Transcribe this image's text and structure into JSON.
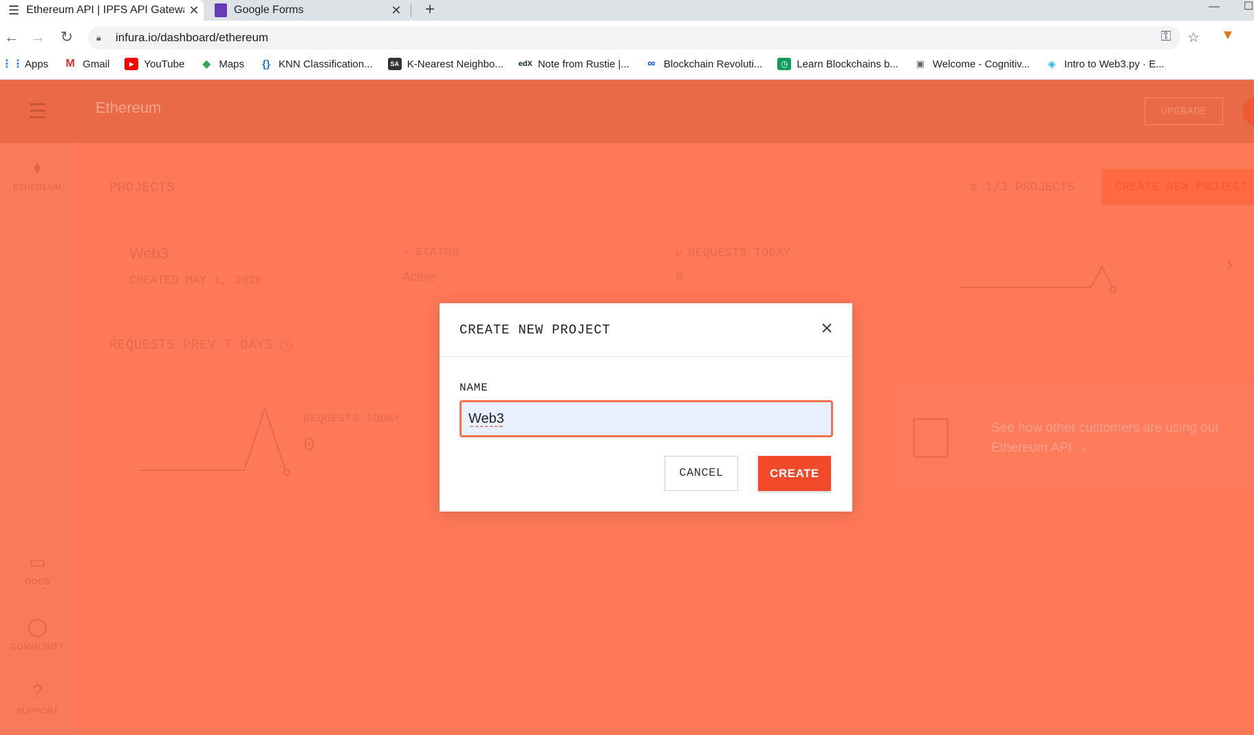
{
  "browser": {
    "tabs": [
      {
        "title": "Ethereum API | IPFS API Gateway",
        "close": "✕"
      },
      {
        "title": "Google Forms",
        "close": "✕"
      }
    ],
    "new_tab": "+",
    "url": "infura.io/dashboard/ethereum",
    "bookmarks": [
      {
        "label": "Apps",
        "icon": "apps-grid-icon"
      },
      {
        "label": "Gmail",
        "icon": "gmail-icon"
      },
      {
        "label": "YouTube",
        "icon": "youtube-icon"
      },
      {
        "label": "Maps",
        "icon": "maps-icon"
      },
      {
        "label": "KNN Classification...",
        "icon": "braces-icon"
      },
      {
        "label": "K-Nearest Neighbo...",
        "icon": "sa-icon"
      },
      {
        "label": "Note from Rustie |...",
        "icon": "edx-icon"
      },
      {
        "label": "Blockchain Revoluti...",
        "icon": "coursera-icon"
      },
      {
        "label": "Learn Blockchains b...",
        "icon": "clock-icon"
      },
      {
        "label": "Welcome - Cognitiv...",
        "icon": "cognitive-icon"
      },
      {
        "label": "Intro to Web3.py · E...",
        "icon": "web3-icon"
      }
    ]
  },
  "app": {
    "title": "Ethereum",
    "upgrade_label": "UPGRADE",
    "sidebar": [
      {
        "label": "ETHEREUM",
        "icon": "ethereum-icon"
      },
      {
        "label": "DOCS",
        "icon": "book-icon"
      },
      {
        "label": "COMMUNITY",
        "icon": "chat-icon"
      },
      {
        "label": "SUPPORT",
        "icon": "help-icon"
      }
    ],
    "projects_header": "PROJECTS",
    "projects_count": "1/3 PROJECTS",
    "create_new_label": "CREATE NEW PROJECT",
    "project": {
      "name": "Web3",
      "created": "CREATED MAY 1, 2020",
      "status_label": "STATUS",
      "status_value": "Active",
      "requests_label": "REQUESTS TODAY",
      "requests_value": "0"
    },
    "requests_prev_header": "REQUESTS PREV 7 DAYS",
    "requests_today_label": "REQUESTS TODAY",
    "requests_today_value": "0",
    "promo_text": "See how other customers are using our Ethereum API →"
  },
  "modal": {
    "title": "CREATE NEW PROJECT",
    "name_label": "NAME",
    "name_value": "Web3",
    "cancel_label": "CANCEL",
    "create_label": "CREATE"
  },
  "colors": {
    "overlay": "#ff7858",
    "accent": "#f2492a"
  }
}
